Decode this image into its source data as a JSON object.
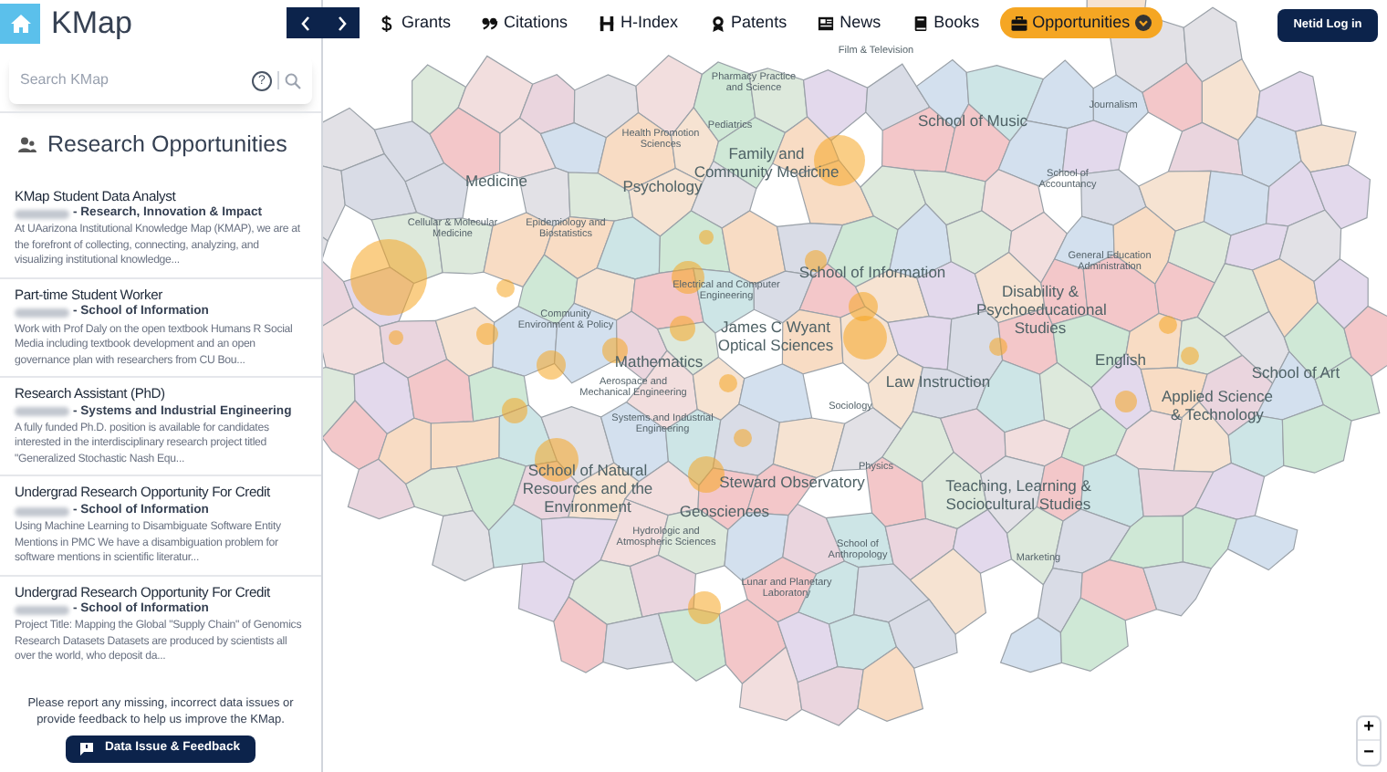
{
  "app": {
    "title": "KMap"
  },
  "search": {
    "placeholder": "Search KMap",
    "help": "?"
  },
  "panel": {
    "title": "Research Opportunities"
  },
  "opportunities": [
    {
      "title": "KMap Student Data Analyst",
      "department": "- Research, Innovation & Impact",
      "description": "At UAarizona Institutional Knowledge Map (KMAP), we are at the forefront of collecting, connecting, analyzing, and visualizing institutional knowledge..."
    },
    {
      "title": "Part-time Student Worker",
      "department": "- School of Information",
      "description": "Work with Prof Daly on the open textbook Humans R Social Media including textbook development and an open governance plan with researchers from CU Bou..."
    },
    {
      "title": "Research Assistant (PhD)",
      "department": "- Systems and Industrial Engineering",
      "description": "A fully funded Ph.D. position is available for candidates interested in the interdisciplinary research project titled \"Generalized Stochastic Nash Equ..."
    },
    {
      "title": "Undergrad Research Opportunity For Credit",
      "department": "- School of Information",
      "description": "Using Machine Learning to Disambiguate Software Entity Mentions in PMC We have a disambiguation problem for software mentions in scientific literatur..."
    },
    {
      "title": "Undergrad Research Opportunity For Credit",
      "department": "- School of Information",
      "description": "Project Title: Mapping the Global \"Supply Chain\" of Genomics Research Datasets Datasets are produced by scientists all over the world, who deposit da..."
    }
  ],
  "feedback": {
    "note": "Please report any missing, incorrect data issues or provide feedback to help us improve the KMap.",
    "button": "Data Issue & Feedback"
  },
  "tabs": [
    {
      "label": "Grants",
      "kind": "dollar",
      "selected": false
    },
    {
      "label": "Citations",
      "kind": "quote",
      "selected": false
    },
    {
      "label": "H-Index",
      "kind": "h",
      "selected": false
    },
    {
      "label": "Patents",
      "kind": "award",
      "selected": false
    },
    {
      "label": "News",
      "kind": "newspaper",
      "selected": false
    },
    {
      "label": "Books",
      "kind": "book",
      "selected": false
    },
    {
      "label": "Opportunities",
      "kind": "briefcase",
      "selected": true
    }
  ],
  "login": "Netid Log in",
  "zoom": {
    "in": "+",
    "out": "−"
  },
  "map_labels": [
    {
      "text": "Medicine",
      "kind": "major"
    },
    {
      "text": "Psychology",
      "kind": "major"
    },
    {
      "text": "Family and Community Medicine",
      "kind": "major"
    },
    {
      "text": "School of Information",
      "kind": "major"
    },
    {
      "text": "James C Wyant Optical Sciences",
      "kind": "major"
    },
    {
      "text": "Mathematics",
      "kind": "major"
    },
    {
      "text": "Law Instruction",
      "kind": "major"
    },
    {
      "text": "English",
      "kind": "major"
    },
    {
      "text": "Disability & Psychoeducational Studies",
      "kind": "major"
    },
    {
      "text": "Applied Science & Technology",
      "kind": "major"
    },
    {
      "text": "School of Art",
      "kind": "major"
    },
    {
      "text": "School of Music",
      "kind": "major"
    },
    {
      "text": "School of Natural Resources and the Environment",
      "kind": "major"
    },
    {
      "text": "Steward Observatory",
      "kind": "major"
    },
    {
      "text": "Teaching, Learning & Sociocultural Studies",
      "kind": "major"
    },
    {
      "text": "Geosciences",
      "kind": "major"
    },
    {
      "text": "Film & Television",
      "kind": "minor"
    },
    {
      "text": "Pharmacy Practice and Science",
      "kind": "minor"
    },
    {
      "text": "Pediatrics",
      "kind": "minor"
    },
    {
      "text": "Health Promotion Sciences",
      "kind": "minor"
    },
    {
      "text": "Cellular & Molecular Medicine",
      "kind": "minor"
    },
    {
      "text": "Epidemiology and Biostatistics",
      "kind": "minor"
    },
    {
      "text": "Electrical and Computer Engineering",
      "kind": "minor"
    },
    {
      "text": "Aerospace and Mechanical Engineering",
      "kind": "minor"
    },
    {
      "text": "Systems and Industrial Engineering",
      "kind": "minor"
    },
    {
      "text": "Hydrologic and Atmospheric Sciences",
      "kind": "minor"
    },
    {
      "text": "Lunar and Planetary Laboratory",
      "kind": "minor"
    },
    {
      "text": "Physics",
      "kind": "minor"
    },
    {
      "text": "Marketing",
      "kind": "minor"
    },
    {
      "text": "Journalism",
      "kind": "minor"
    },
    {
      "text": "School of Accountancy",
      "kind": "minor"
    },
    {
      "text": "General Education Administration",
      "kind": "minor"
    },
    {
      "text": "Community Environment & Policy",
      "kind": "minor"
    },
    {
      "text": "Sociology",
      "kind": "minor"
    },
    {
      "text": "School of Anthropology",
      "kind": "minor"
    }
  ]
}
